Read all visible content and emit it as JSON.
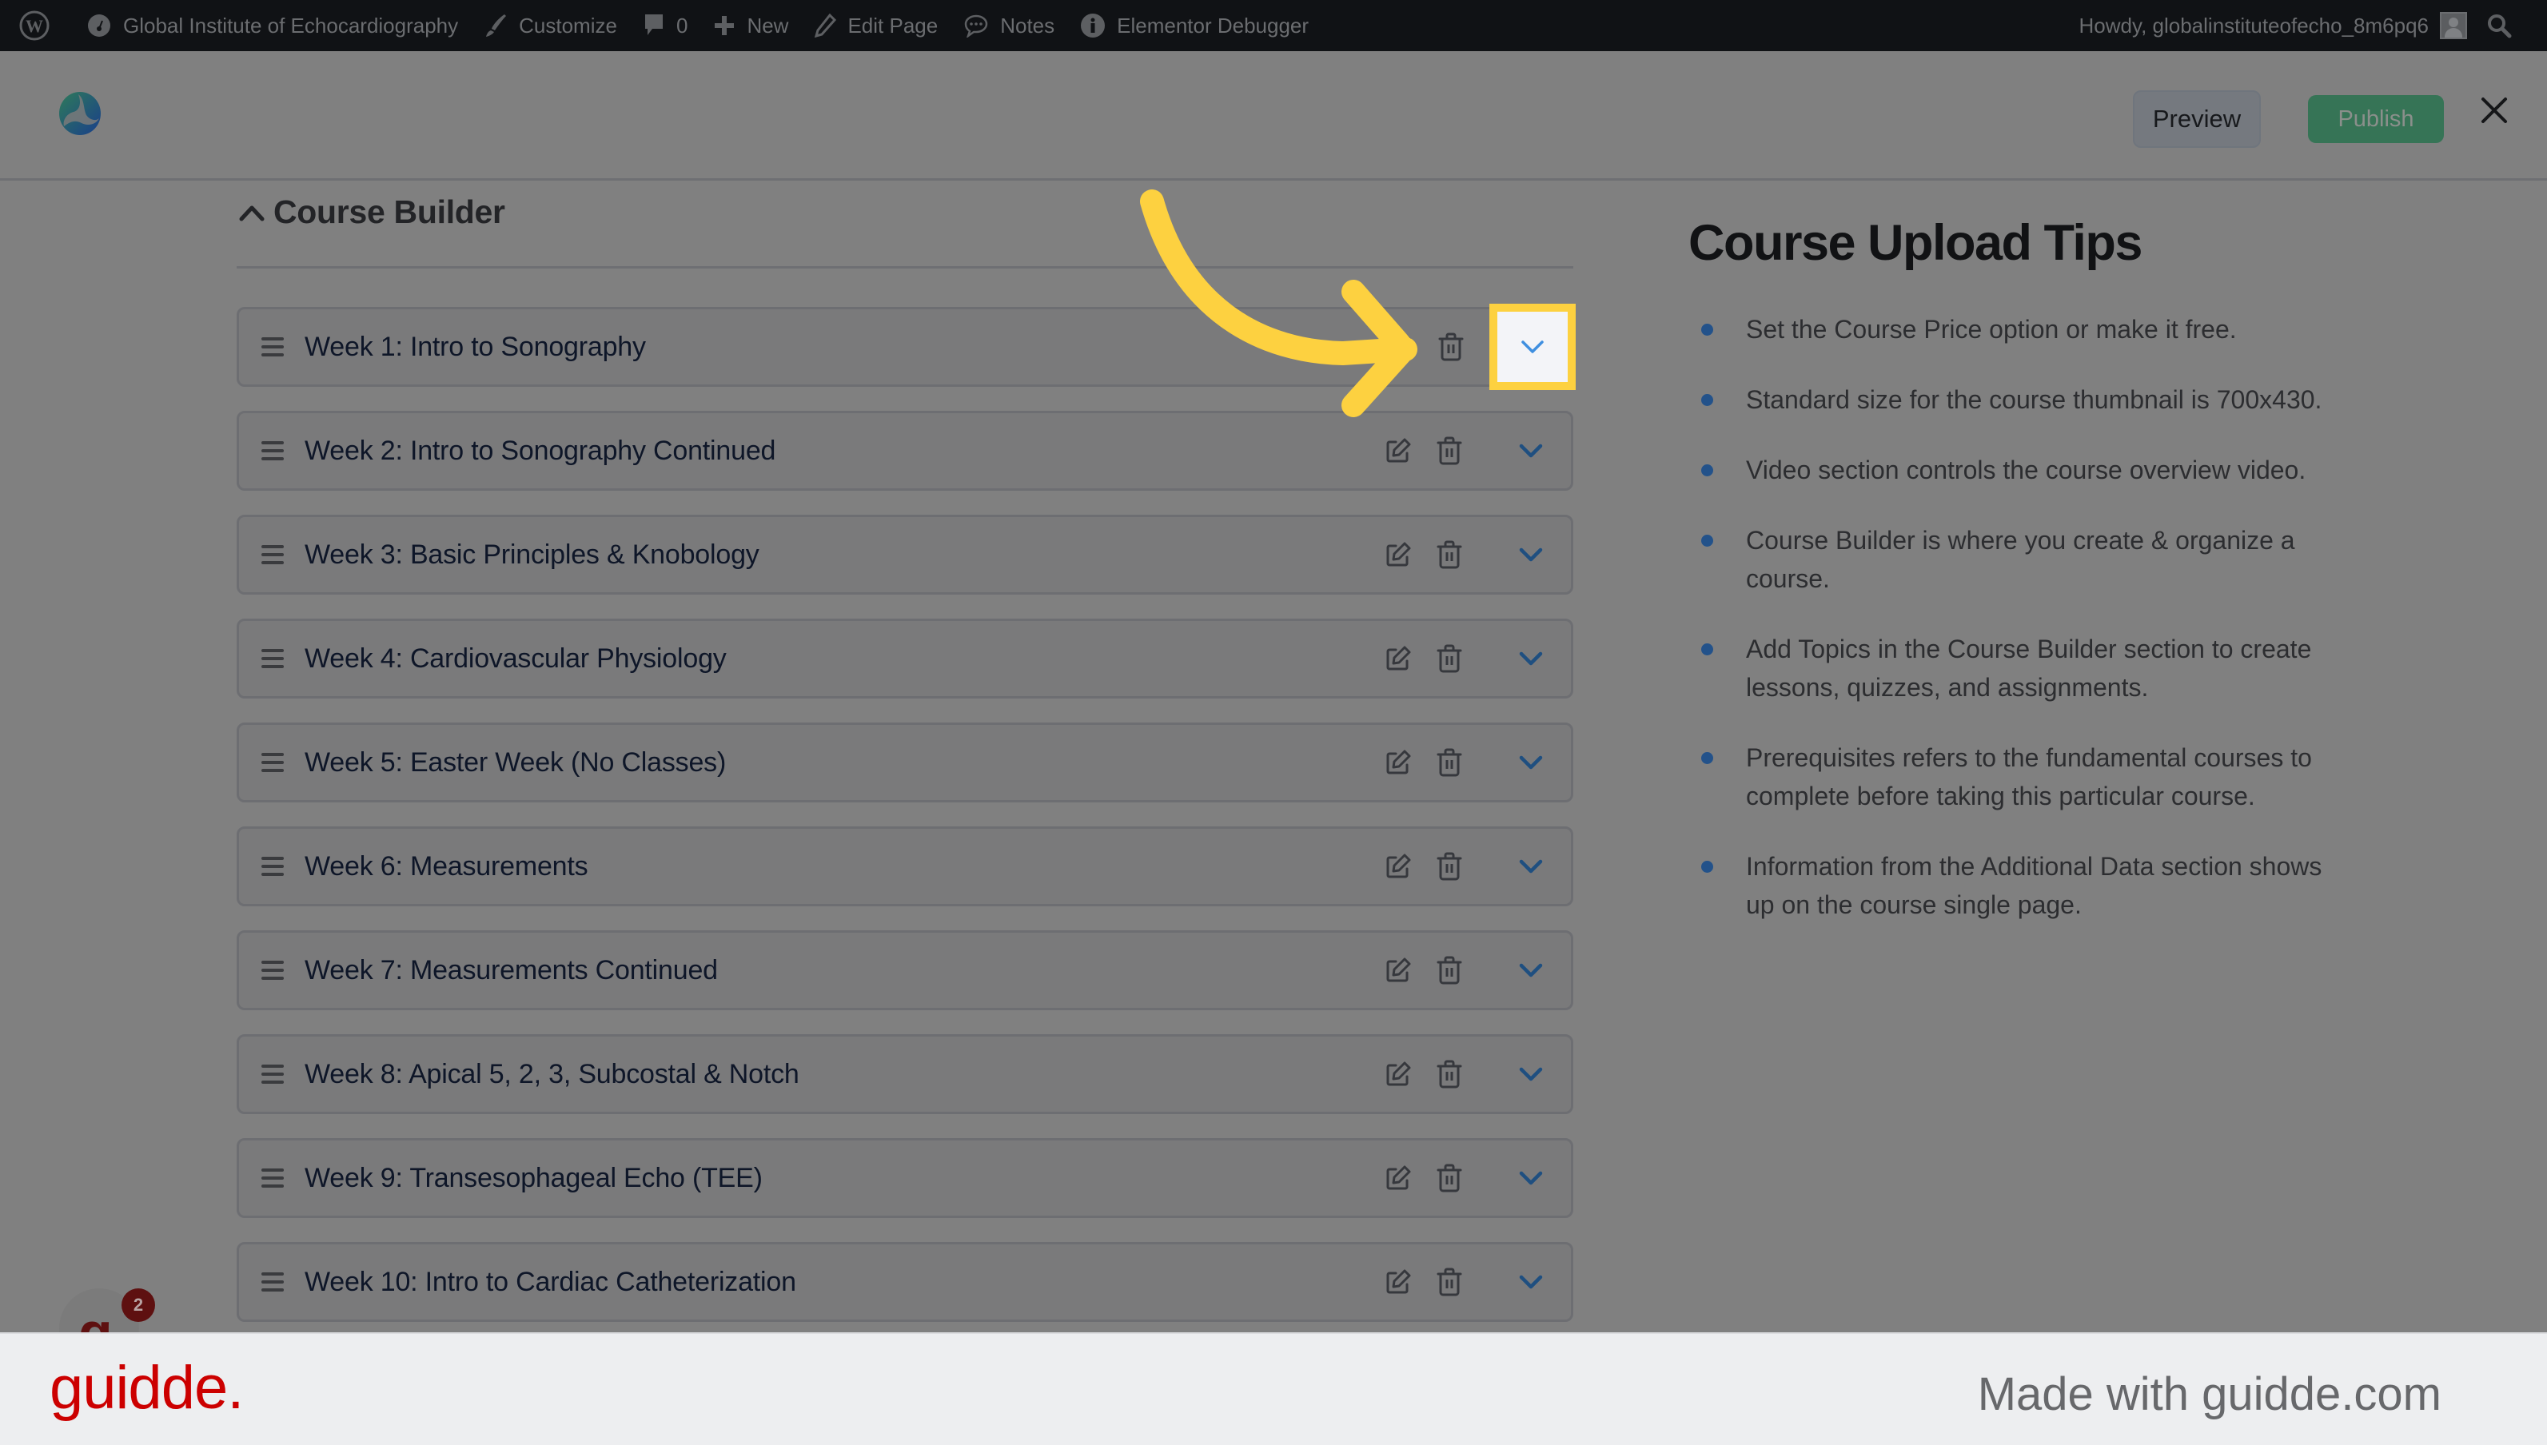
{
  "admin_bar": {
    "site_name": "Global Institute of Echocardiography",
    "customize": "Customize",
    "comments_count": "0",
    "new": "New",
    "edit_page": "Edit Page",
    "notes": "Notes",
    "debugger": "Elementor Debugger",
    "greeting": "Howdy, globalinstituteofecho_8m6pq6"
  },
  "header": {
    "preview_label": "Preview",
    "publish_label": "Publish"
  },
  "course_builder": {
    "title": "Course Builder",
    "topics": [
      {
        "title": "Week 1: Intro to Sonography",
        "highlighted": true
      },
      {
        "title": "Week 2: Intro to Sonography Continued"
      },
      {
        "title": "Week 3: Basic Principles & Knobology"
      },
      {
        "title": "Week 4: Cardiovascular Physiology"
      },
      {
        "title": "Week 5: Easter Week (No Classes)"
      },
      {
        "title": "Week 6: Measurements"
      },
      {
        "title": "Week 7: Measurements Continued"
      },
      {
        "title": "Week 8: Apical 5, 2, 3, Subcostal & Notch"
      },
      {
        "title": "Week 9: Transesophageal Echo (TEE)"
      },
      {
        "title": "Week 10: Intro to Cardiac Catheterization"
      }
    ]
  },
  "tips": {
    "title": "Course Upload Tips",
    "items": [
      "Set the Course Price option or make it free.",
      "Standard size for the course thumbnail is 700x430.",
      "Video section controls the course overview video.",
      "Course Builder is where you create & organize a course.",
      "Add Topics in the Course Builder section to create lessons, quizzes, and assignments.",
      "Prerequisites refers to the fundamental courses to complete before taking this particular course.",
      "Information from the Additional Data section shows up on the course single page."
    ]
  },
  "chat_badge": {
    "letter": "g",
    "count": "2"
  },
  "footer": {
    "logo": "guidde.",
    "made_with": "Made with guidde.com"
  },
  "colors": {
    "annotation": "#fdd140",
    "publish": "#367456",
    "chevron": "#1f4f80",
    "chevron_active": "#3f8fe0",
    "bullet": "#23528a",
    "guidde_red": "#cc0000"
  }
}
